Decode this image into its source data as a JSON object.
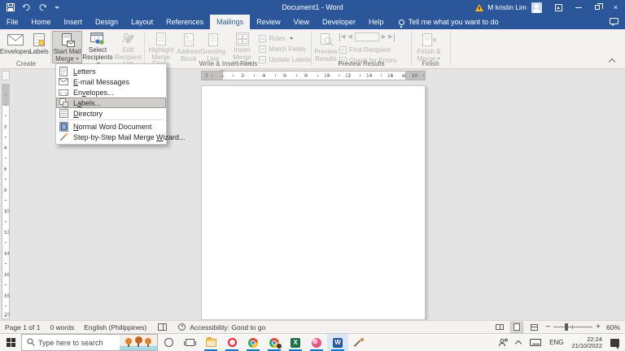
{
  "titlebar": {
    "title": "Document1 - Word",
    "user": "M kristin Lim",
    "window": {
      "close": "×"
    }
  },
  "tabs": {
    "items": [
      "File",
      "Home",
      "Insert",
      "Design",
      "Layout",
      "References",
      "Mailings",
      "Review",
      "View",
      "Developer",
      "Help"
    ],
    "tellme": "Tell me what you want to do"
  },
  "ribbon": {
    "create": {
      "label": "Create",
      "envelopes": "Envelopes",
      "labels": "Labels"
    },
    "smm": {
      "b1l1": "Start Mail",
      "b1l2": "Merge",
      "b2l1": "Select",
      "b2l2": "Recipients",
      "b3l1": "Edit",
      "b3l2": "Recipient List"
    },
    "wif": {
      "label": "Write & Insert Fields",
      "b1l1": "Highlight",
      "b1l2": "Merge Fields",
      "b2l1": "Address",
      "b2l2": "Block",
      "b3l1": "Greeting",
      "b3l2": "Line",
      "b4l1": "Insert Merge",
      "b4l2": "Field",
      "s1": "Rules",
      "s2": "Match Fields",
      "s3": "Update Labels"
    },
    "preview": {
      "label": "Preview Results",
      "b1l1": "Preview",
      "b1l2": "Results",
      "s1": "Find Recipient",
      "s2": "Check for Errors",
      "nav_first": "◀",
      "nav_prev": "◀",
      "nav_next": "▶",
      "nav_last": "▶"
    },
    "finish": {
      "label": "Finish",
      "b1l1": "Finish &",
      "b1l2": "Merge"
    }
  },
  "menu": {
    "items": [
      {
        "pre": "",
        "key": "L",
        "post": "etters"
      },
      {
        "pre": "",
        "key": "E",
        "post": "-mail Messages"
      },
      {
        "pre": "En",
        "key": "v",
        "post": "elopes..."
      },
      {
        "pre": "L",
        "key": "a",
        "post": "bels..."
      },
      {
        "pre": "",
        "key": "D",
        "post": "irectory"
      },
      {
        "pre": "",
        "key": "N",
        "post": "ormal Word Document"
      },
      {
        "pre": "Step-by-Step Mail Merge ",
        "key": "W",
        "post": "izard..."
      }
    ]
  },
  "ruler": {
    "h": [
      "2",
      "2",
      "4",
      "6",
      "8",
      "10",
      "12",
      "14",
      "16",
      "18"
    ],
    "v": [
      "2",
      "4",
      "6",
      "8",
      "10",
      "12",
      "14",
      "16",
      "18",
      "20"
    ]
  },
  "statusbar": {
    "page": "Page 1 of 1",
    "words": "0 words",
    "language": "English (Philippines)",
    "accessibility": "Accessibility: Good to go",
    "zoom": {
      "out": "−",
      "in": "+",
      "value": "60%"
    }
  },
  "taskbar": {
    "search_placeholder": "Type here to search",
    "tray": {
      "lang": "ENG",
      "time": "22:24",
      "date": "21/10/2022"
    }
  }
}
